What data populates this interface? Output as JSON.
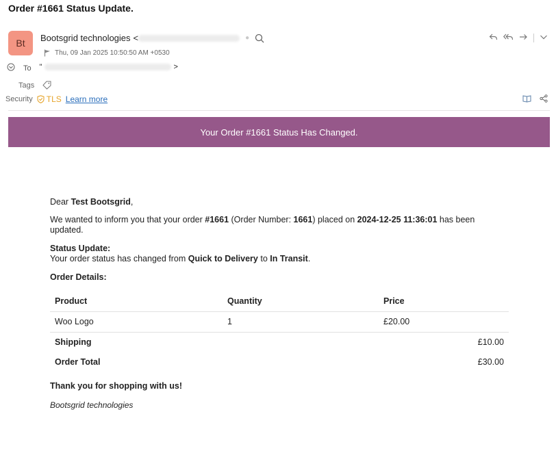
{
  "email": {
    "subject": "Order #1661 Status Update.",
    "avatar_initials": "Bt",
    "sender_name": "Bootsgrid technologies",
    "sender_email_prefix": "<",
    "date": "Thu, 09 Jan 2025 10:50:50 AM +0530",
    "to_label": "To",
    "to_value_prefix": "\"",
    "to_value_suffix": ">",
    "tags_label": "Tags",
    "security_label": "Security",
    "tls_label": "TLS",
    "learn_more": "Learn more"
  },
  "banner": {
    "text": "Your Order #1661 Status Has Changed.",
    "color": "#96588a"
  },
  "body": {
    "greeting_prefix": "Dear ",
    "customer_name": "Test Bootsgrid",
    "greeting_suffix": ",",
    "intro_1": "We wanted to inform you that your order ",
    "order_ref": "#1661",
    "intro_2": " (Order Number: ",
    "order_number": "1661",
    "intro_3": ") placed on ",
    "order_date": "2024-12-25 11:36:01",
    "intro_4": " has been updated.",
    "status_heading": "Status Update:",
    "status_1": "Your order status has changed from ",
    "status_from": "Quick to Delivery",
    "status_2": " to ",
    "status_to": "In Transit",
    "status_3": ".",
    "details_heading": "Order Details:",
    "table": {
      "headers": [
        "Product",
        "Quantity",
        "Price"
      ],
      "rows": [
        [
          "Woo Logo",
          "1",
          "£20.00"
        ]
      ],
      "shipping_label": "Shipping",
      "shipping_value": "£10.00",
      "total_label": "Order Total",
      "total_value": "£30.00"
    },
    "thanks": "Thank you for shopping with us!",
    "signature": "Bootsgrid technologies"
  }
}
